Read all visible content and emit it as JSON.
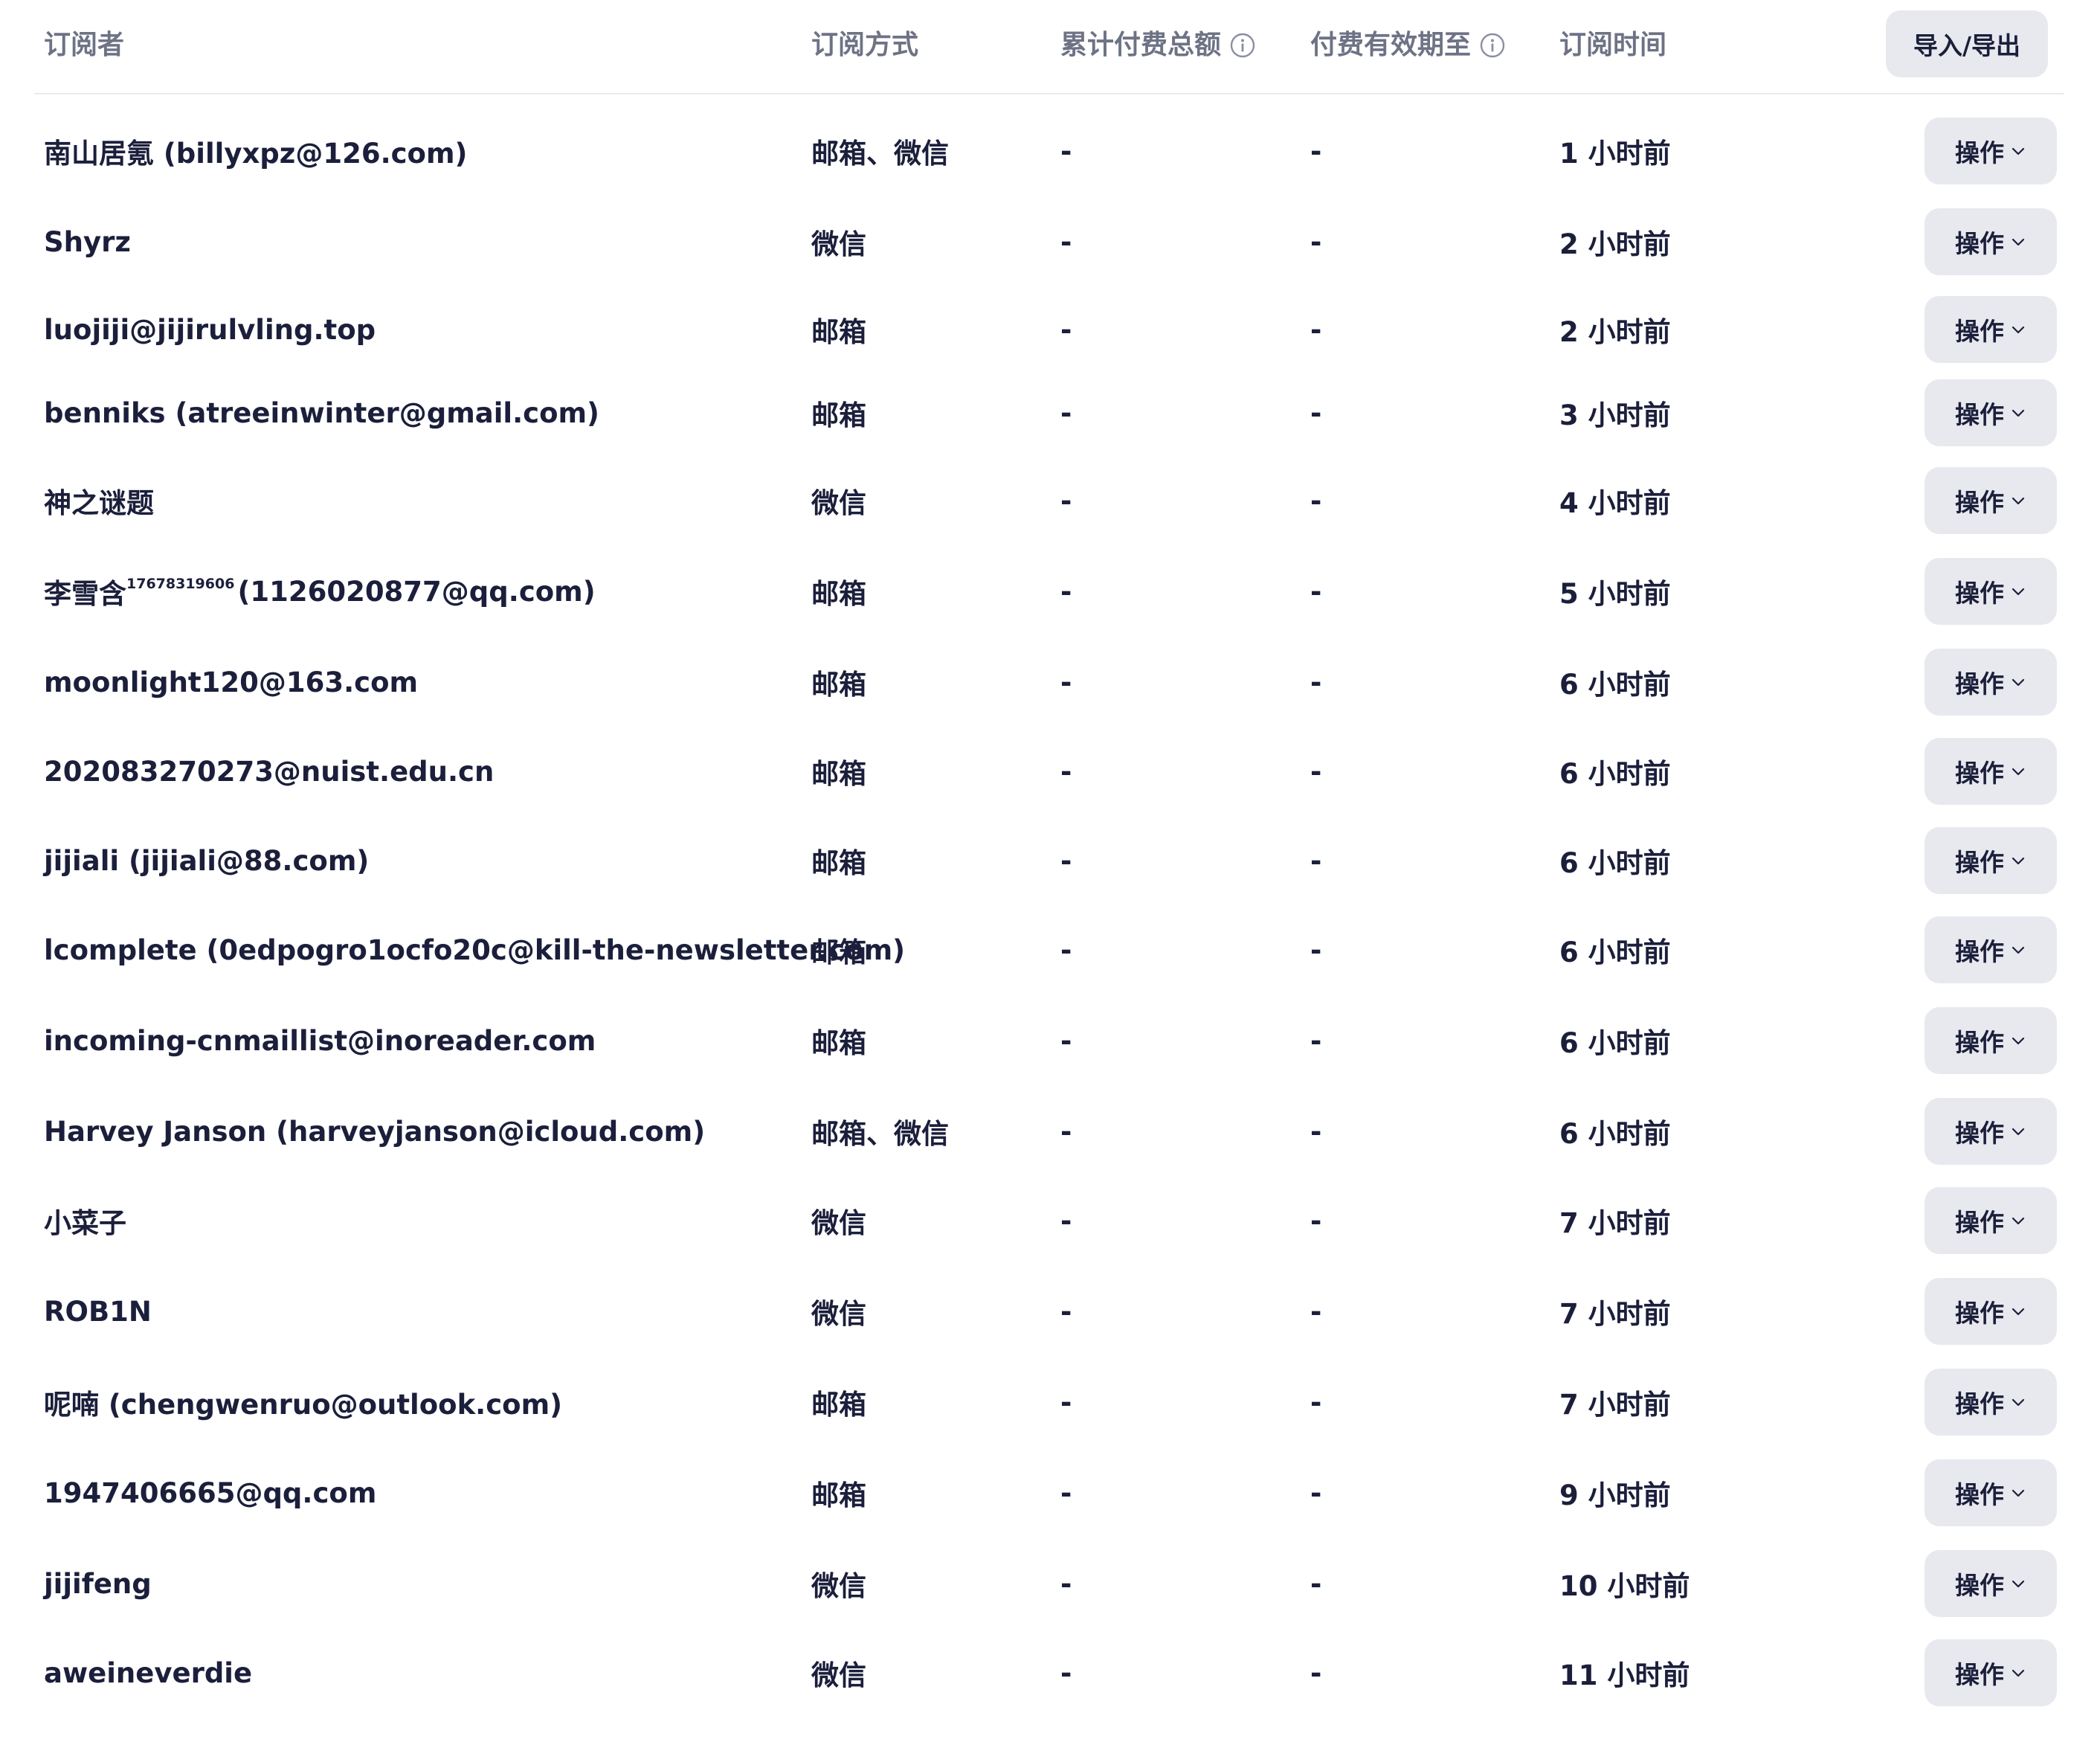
{
  "header": {
    "subscriber": "订阅者",
    "method": "订阅方式",
    "total_paid": "累计付费总额",
    "total_paid_icon": "info-icon",
    "valid_until": "付费有效期至",
    "valid_until_icon": "info-icon",
    "subscribed_at": "订阅时间",
    "import_export_label": "导入/导出"
  },
  "action_label": "操作",
  "action_icon": "chevron-down-icon",
  "rows": [
    {
      "name": "南山居氪 (billyxpz@126.com)",
      "sup": "",
      "name_after": "",
      "method": "邮箱、微信",
      "total": "-",
      "expire": "-",
      "time": "1 小时前"
    },
    {
      "name": "Shyrz",
      "sup": "",
      "name_after": "",
      "method": "微信",
      "total": "-",
      "expire": "-",
      "time": "2 小时前"
    },
    {
      "name": "luojiji@jijirulvling.top",
      "sup": "",
      "name_after": "",
      "method": "邮箱",
      "total": "-",
      "expire": "-",
      "time": "2 小时前"
    },
    {
      "name": "benniks (atreeinwinter@gmail.com)",
      "sup": "",
      "name_after": "",
      "method": "邮箱",
      "total": "-",
      "expire": "-",
      "time": "3 小时前"
    },
    {
      "name": "神之谜题",
      "sup": "",
      "name_after": "",
      "method": "微信",
      "total": "-",
      "expire": "-",
      "time": "4 小时前"
    },
    {
      "name": "李雪含",
      "sup": "17678319606",
      "name_after": " (1126020877@qq.com)",
      "method": "邮箱",
      "total": "-",
      "expire": "-",
      "time": "5 小时前"
    },
    {
      "name": "moonlight120@163.com",
      "sup": "",
      "name_after": "",
      "method": "邮箱",
      "total": "-",
      "expire": "-",
      "time": "6 小时前"
    },
    {
      "name": "202083270273@nuist.edu.cn",
      "sup": "",
      "name_after": "",
      "method": "邮箱",
      "total": "-",
      "expire": "-",
      "time": "6 小时前"
    },
    {
      "name": "jijiali (jijiali@88.com)",
      "sup": "",
      "name_after": "",
      "method": "邮箱",
      "total": "-",
      "expire": "-",
      "time": "6 小时前"
    },
    {
      "name": "lcomplete (0edpogro1ocfo20c@kill-the-newsletter.com)",
      "sup": "",
      "name_after": "",
      "method": "邮箱",
      "total": "-",
      "expire": "-",
      "time": "6 小时前"
    },
    {
      "name": "incoming-cnmaillist@inoreader.com",
      "sup": "",
      "name_after": "",
      "method": "邮箱",
      "total": "-",
      "expire": "-",
      "time": "6 小时前"
    },
    {
      "name": "Harvey Janson (harveyjanson@icloud.com)",
      "sup": "",
      "name_after": "",
      "method": "邮箱、微信",
      "total": "-",
      "expire": "-",
      "time": "6 小时前"
    },
    {
      "name": "小菜子",
      "sup": "",
      "name_after": "",
      "method": "微信",
      "total": "-",
      "expire": "-",
      "time": "7 小时前"
    },
    {
      "name": "ROB1N",
      "sup": "",
      "name_after": "",
      "method": "微信",
      "total": "-",
      "expire": "-",
      "time": "7 小时前"
    },
    {
      "name": "呢喃 (chengwenruo@outlook.com)",
      "sup": "",
      "name_after": "",
      "method": "邮箱",
      "total": "-",
      "expire": "-",
      "time": "7 小时前"
    },
    {
      "name": "1947406665@qq.com",
      "sup": "",
      "name_after": "",
      "method": "邮箱",
      "total": "-",
      "expire": "-",
      "time": "9 小时前"
    },
    {
      "name": "jijifeng",
      "sup": "",
      "name_after": "",
      "method": "微信",
      "total": "-",
      "expire": "-",
      "time": "10 小时前"
    },
    {
      "name": "aweineverdie",
      "sup": "",
      "name_after": "",
      "method": "微信",
      "total": "-",
      "expire": "-",
      "time": "11 小时前"
    }
  ]
}
